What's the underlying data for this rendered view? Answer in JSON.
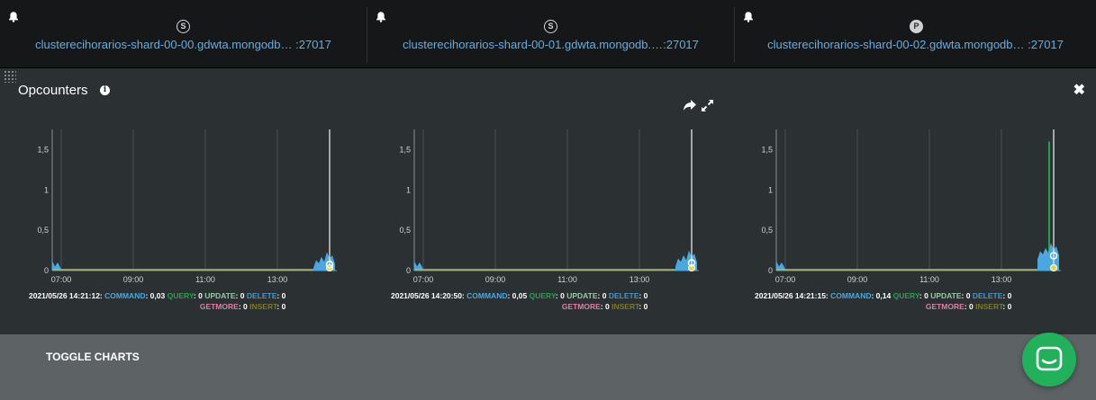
{
  "hosts": [
    {
      "name": "clusterecihorarios-shard-00-00.gdwta.mongodb… :27017",
      "role": "S"
    },
    {
      "name": "clusterecihorarios-shard-00-01.gdwta.mongodb.…:27017",
      "role": "S"
    },
    {
      "name": "clusterecihorarios-shard-00-02.gdwta.mongodb… :27017",
      "role": "P"
    }
  ],
  "panel": {
    "title": "Opcounters",
    "info_glyph": "i",
    "close_glyph": "✖"
  },
  "x_axis": {
    "ticks": [
      "07:00",
      "09:00",
      "11:00",
      "13:00"
    ]
  },
  "y_axis": {
    "ticks": [
      "0",
      "0,5",
      "1",
      "1,5"
    ]
  },
  "charts": [
    {
      "timestamp": "2021/05/26 14:21:12:",
      "command": "0,03",
      "query": "0",
      "update": "0",
      "delete": "0",
      "getmore": "0",
      "insert": "0"
    },
    {
      "timestamp": "2021/05/26 14:20:50:",
      "command": "0,05",
      "query": "0",
      "update": "0",
      "delete": "0",
      "getmore": "0",
      "insert": "0"
    },
    {
      "timestamp": "2021/05/26 14:21:15:",
      "command": "0,14",
      "query": "0",
      "update": "0",
      "delete": "0",
      "getmore": "0",
      "insert": "0"
    }
  ],
  "labels": {
    "command": "COMMAND",
    "query": "QUERY",
    "update": "UPDATE",
    "delete": "DELETE",
    "getmore": "GETMORE",
    "insert": "INSERT"
  },
  "chart_data": [
    {
      "type": "area",
      "title": "",
      "x": [
        "07:00",
        "09:00",
        "11:00",
        "13:00"
      ],
      "ylim": [
        0,
        1.75
      ],
      "series": [
        {
          "name": "COMMAND",
          "color": "#4aa8e0",
          "values": [
            0,
            0,
            0,
            0.03
          ]
        },
        {
          "name": "QUERY",
          "color": "#27a150",
          "values": [
            0,
            0,
            0,
            0
          ]
        }
      ]
    },
    {
      "type": "area",
      "title": "",
      "x": [
        "07:00",
        "09:00",
        "11:00",
        "13:00"
      ],
      "ylim": [
        0,
        1.75
      ],
      "series": [
        {
          "name": "COMMAND",
          "color": "#4aa8e0",
          "values": [
            0,
            0,
            0,
            0.05
          ]
        },
        {
          "name": "QUERY",
          "color": "#27a150",
          "values": [
            0,
            0,
            0,
            0
          ]
        }
      ]
    },
    {
      "type": "area",
      "title": "",
      "x": [
        "07:00",
        "09:00",
        "11:00",
        "13:00"
      ],
      "ylim": [
        0,
        1.75
      ],
      "series": [
        {
          "name": "COMMAND",
          "color": "#4aa8e0",
          "values": [
            0,
            0,
            0,
            0.14
          ]
        },
        {
          "name": "QUERY",
          "color": "#27a150",
          "values": [
            0,
            0,
            0,
            1.6
          ]
        }
      ]
    }
  ],
  "toggle_label": "TOGGLE CHARTS",
  "colors": {
    "link": "#5eb0e8",
    "command": "#4aa8e0",
    "query": "#27a150",
    "chat": "#20b15a"
  }
}
